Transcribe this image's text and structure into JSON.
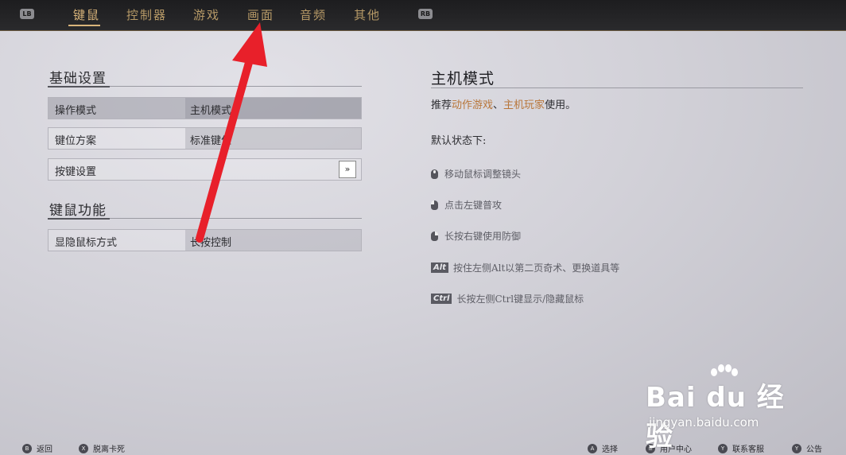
{
  "topbar": {
    "lb": "LB",
    "rb": "RB",
    "tabs": [
      {
        "label": "键鼠",
        "active": true
      },
      {
        "label": "控制器"
      },
      {
        "label": "游戏"
      },
      {
        "label": "画面"
      },
      {
        "label": "音频"
      },
      {
        "label": "其他"
      }
    ]
  },
  "left": {
    "section1_title": "基础设置",
    "rows1": [
      {
        "label": "操作模式",
        "value": "主机模式"
      },
      {
        "label": "键位方案",
        "value": "标准键位"
      },
      {
        "label": "按键设置",
        "value": "",
        "button": "»"
      }
    ],
    "section2_title": "键鼠功能",
    "rows2": [
      {
        "label": "显隐鼠标方式",
        "value": "长按控制"
      }
    ]
  },
  "right": {
    "title": "主机模式",
    "desc_prefix": "推荐",
    "desc_hl1": "动作游戏",
    "desc_sep": "、",
    "desc_hl2": "主机玩家",
    "desc_suffix": "使用。",
    "default_label": "默认状态下:",
    "lines": [
      {
        "icon": "mouse-move-icon",
        "text": "移动鼠标调整镜头"
      },
      {
        "icon": "mouse-left-icon",
        "text": "点击左键普攻"
      },
      {
        "icon": "mouse-right-icon",
        "text": "长按右键使用防御"
      },
      {
        "key": "Alt",
        "text": "按住左侧Alt以第二页奇术、更换道具等"
      },
      {
        "key": "Ctrl",
        "text": "长按左侧Ctrl键显示/隐藏鼠标"
      }
    ],
    "highlight_color": "#b8763a"
  },
  "bottom": {
    "left_hints": [
      {
        "btn": "B",
        "label": "返回"
      },
      {
        "btn": "X",
        "label": "脱离卡死"
      }
    ],
    "right_hints": [
      {
        "btn": "A",
        "label": "选择"
      },
      {
        "btn": "≡",
        "label": "用户中心"
      },
      {
        "btn": "Y",
        "label": "联系客服"
      },
      {
        "btn": "Y",
        "label": "公告"
      }
    ]
  },
  "watermark": {
    "main": "Bai du 经验",
    "sub": "jingyan.baidu.com"
  },
  "accent_color": "#d9b47a",
  "arrow_color": "#e8202a"
}
